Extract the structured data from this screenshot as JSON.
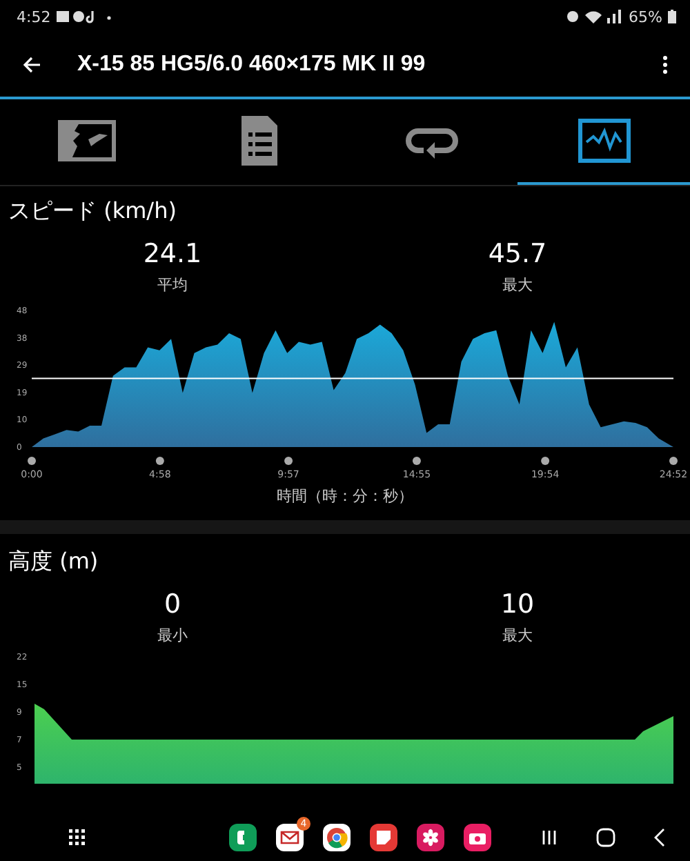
{
  "status_bar": {
    "time": "4:52",
    "battery": "65%"
  },
  "app_bar": {
    "title": "X-15 85 HG5/6.0 460×175 MK II 99"
  },
  "tabs": [
    {
      "kind": "map",
      "selected": false
    },
    {
      "kind": "details",
      "selected": false
    },
    {
      "kind": "laps",
      "selected": false
    },
    {
      "kind": "graph",
      "selected": true
    }
  ],
  "speed": {
    "title": "スピード (km/h)",
    "stats": [
      {
        "value": "24.1",
        "label": "平均"
      },
      {
        "value": "45.7",
        "label": "最大"
      }
    ],
    "chart_data": {
      "type": "area",
      "xlabel": "時間（時：分：秒）",
      "x": [
        0,
        0.45,
        0.9,
        1.35,
        1.8,
        2.25,
        2.7,
        3.15,
        3.6,
        4.05,
        4.5,
        4.95,
        5.4,
        5.85,
        6.3,
        6.75,
        7.2,
        7.65,
        8.1,
        8.55,
        9,
        9.45,
        9.9,
        10.35,
        10.8,
        11.25,
        11.7,
        12.15,
        12.6,
        13.05,
        13.5,
        13.95,
        14.4,
        14.85,
        15.3,
        15.75,
        16.2,
        16.65,
        17.1,
        17.55,
        18,
        18.45,
        18.9,
        19.35,
        19.8,
        20.25,
        20.7,
        21.15,
        21.6,
        22.05,
        22.5,
        22.95,
        23.4,
        23.85,
        24.3,
        24.87
      ],
      "series": [
        {
          "color": "#1ba9d9",
          "values": [
            0,
            3,
            4.5,
            6,
            5.5,
            7.5,
            7.5,
            25,
            28,
            28,
            35,
            34,
            38,
            19,
            33,
            35,
            36,
            40,
            38,
            19,
            33,
            41,
            33,
            37,
            36,
            37,
            20,
            26,
            38,
            40,
            43,
            40,
            34,
            22,
            5,
            8,
            8,
            30,
            38,
            40,
            41,
            25,
            15,
            41,
            33,
            44,
            28,
            35,
            15,
            7,
            8,
            9,
            8.5,
            7,
            3,
            0
          ]
        }
      ],
      "xlim": [
        0,
        24.87
      ],
      "ylim": [
        0,
        48
      ],
      "xticks": [
        {
          "value": 0,
          "label": "0:00"
        },
        {
          "value": 4.97,
          "label": "4:58"
        },
        {
          "value": 9.95,
          "label": "9:57"
        },
        {
          "value": 14.92,
          "label": "14:55"
        },
        {
          "value": 19.9,
          "label": "19:54"
        },
        {
          "value": 24.87,
          "label": "24:52"
        }
      ],
      "yticks": [
        {
          "value": 0,
          "label": "0"
        },
        {
          "value": 9.6,
          "label": "10"
        },
        {
          "value": 19.2,
          "label": "19"
        },
        {
          "value": 28.8,
          "label": "29"
        },
        {
          "value": 38.4,
          "label": "38"
        },
        {
          "value": 48,
          "label": "48"
        }
      ],
      "ref_lines": [
        {
          "axis": "y",
          "value": 24.1
        }
      ]
    }
  },
  "elevation": {
    "title": "高度 (m)",
    "stats": [
      {
        "value": "0",
        "label": "最小"
      },
      {
        "value": "10",
        "label": "最大"
      }
    ],
    "axis_labels": [
      "22",
      "15",
      "9",
      "7",
      "5"
    ]
  },
  "nav_bar": {
    "apps": [
      {
        "kind": "phone"
      },
      {
        "kind": "mail",
        "badge": "4"
      },
      {
        "kind": "browser"
      },
      {
        "kind": "notes"
      },
      {
        "kind": "flower"
      },
      {
        "kind": "camera"
      }
    ]
  }
}
